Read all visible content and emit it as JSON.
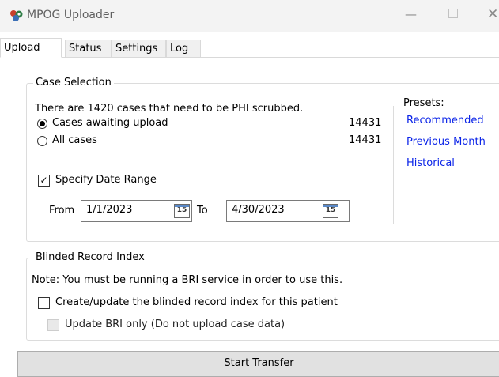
{
  "window": {
    "title": "MPOG Uploader"
  },
  "tabs": [
    {
      "label": "Upload",
      "active": true
    },
    {
      "label": "Status"
    },
    {
      "label": "Settings"
    },
    {
      "label": "Log"
    }
  ],
  "case_selection": {
    "legend": "Case Selection",
    "summary": "There are 1420 cases that need to be PHI scrubbed.",
    "options": [
      {
        "label": "Cases awaiting upload",
        "count": "14431",
        "selected": true
      },
      {
        "label": "All cases",
        "count": "14431",
        "selected": false
      }
    ],
    "specify_date_range": {
      "label": "Specify Date Range",
      "checked": true
    },
    "from": {
      "label": "From",
      "value": "1/1/2023"
    },
    "to": {
      "label": "To",
      "value": "4/30/2023"
    },
    "calendar_glyph": "15",
    "presets": {
      "title": "Presets:",
      "items": [
        "Recommended",
        "Previous Month",
        "Historical"
      ]
    }
  },
  "bri": {
    "legend": "Blinded Record Index",
    "note": "Note: You must be running a BRI service in order to use this.",
    "create_update": {
      "label": "Create/update the blinded record index for this patient",
      "checked": false
    },
    "update_only": {
      "label": "Update BRI only (Do not upload case data)",
      "checked": false,
      "disabled": true
    }
  },
  "start_button": {
    "label": "Start Transfer"
  },
  "colors": {
    "link": "#0b24e8",
    "titlebar": "#f3f3f3",
    "button": "#e1e1e1"
  }
}
